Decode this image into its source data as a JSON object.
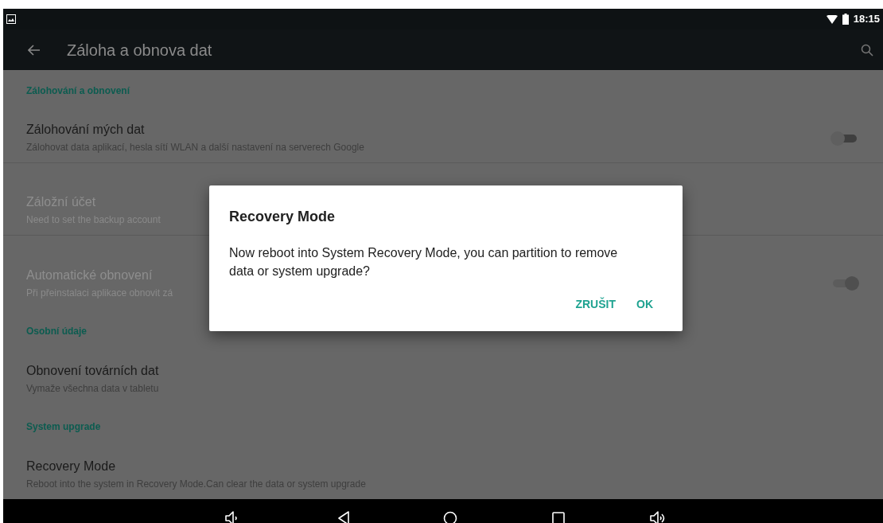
{
  "status_bar": {
    "time": "18:15"
  },
  "app_bar": {
    "title": "Záloha a obnova dat"
  },
  "sections": [
    {
      "header": "Zálohování a obnovení",
      "items": [
        {
          "title": "Zálohování mých dat",
          "summary": "Zálohovat data aplikací, hesla sítí WLAN a další nastavení na serverech Google",
          "kind": "toggle",
          "on": false,
          "disabled": false
        },
        {
          "title": "Záložní účet",
          "summary": "Need to set the backup account",
          "kind": "plain",
          "disabled": true
        },
        {
          "title": "Automatické obnovení",
          "summary": "Při přeinstalaci aplikace obnovit zá",
          "kind": "toggle",
          "on": true,
          "disabled": true
        }
      ]
    },
    {
      "header": "Osobní údaje",
      "items": [
        {
          "title": "Obnovení továrních dat",
          "summary": "Vymaže všechna data v tabletu",
          "kind": "plain",
          "disabled": false
        }
      ]
    },
    {
      "header": "System upgrade",
      "items": [
        {
          "title": "Recovery Mode",
          "summary": "Reboot into the system in Recovery Mode.Can clear the data or system upgrade",
          "kind": "plain",
          "disabled": false
        }
      ]
    }
  ],
  "dialog": {
    "title": "Recovery Mode",
    "message": "Now reboot into System Recovery Mode, you can partition to remove data or system upgrade?",
    "buttons": [
      "ZRUŠIT",
      "OK"
    ]
  }
}
